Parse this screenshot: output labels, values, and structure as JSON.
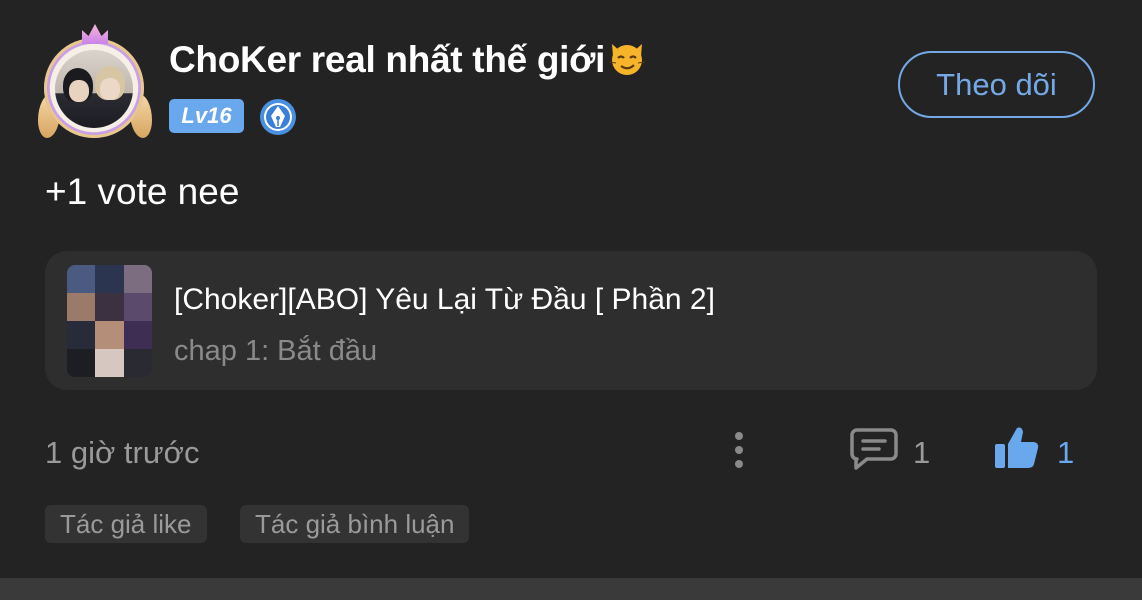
{
  "post": {
    "author": {
      "name": "ChoKer real nhất thế giới",
      "emoji_icon": "smirking-cat-face-icon",
      "level": "Lv16",
      "badge_icon": "pen-nib-badge-icon"
    },
    "follow_label": "Theo dõi",
    "content": "+1 vote nee",
    "story": {
      "title": "[Choker][ABO] Yêu Lại Từ Đầu [ Phần 2]",
      "chapter": "chap 1: Bắt đầu"
    },
    "time": "1 giờ trước",
    "comments": "1",
    "likes": "1",
    "tags": [
      "Tác giả like",
      "Tác giả bình luận"
    ]
  },
  "colors": {
    "background": "#232323",
    "card": "#2e2e2e",
    "accent": "#6aa8ee",
    "muted_text": "#9a9a9a"
  }
}
